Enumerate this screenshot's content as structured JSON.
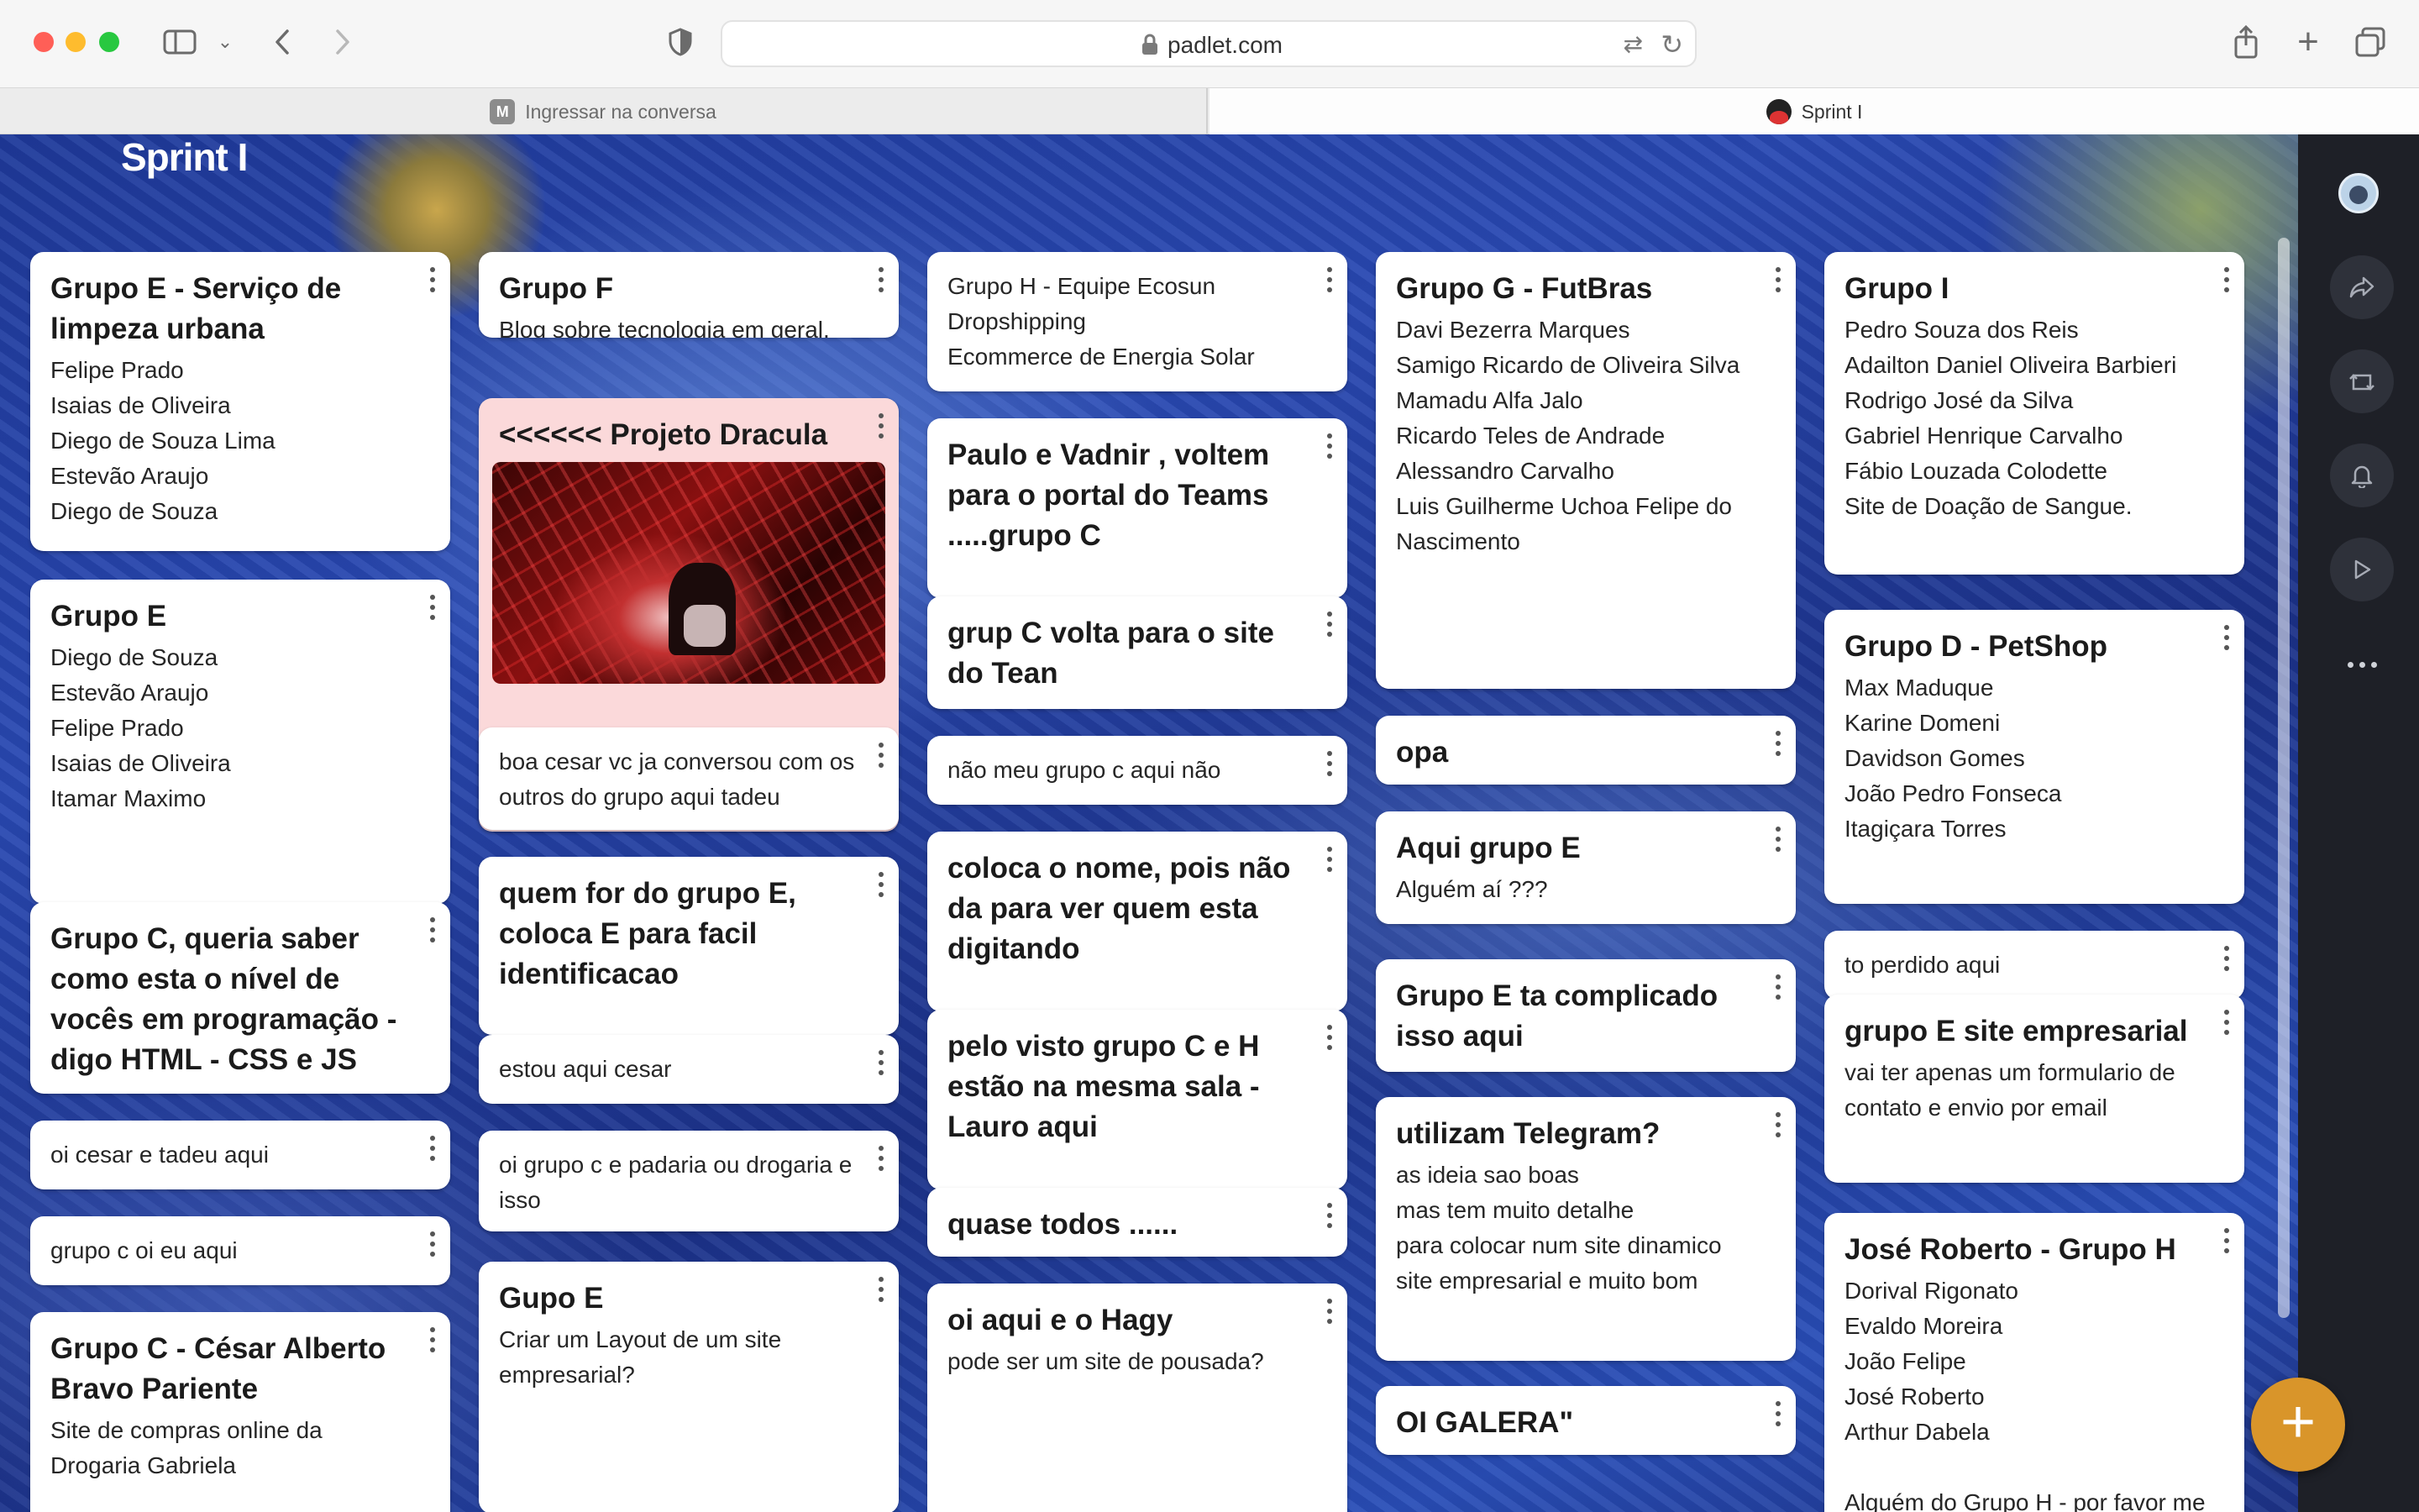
{
  "browser": {
    "url": "padlet.com",
    "tabs": [
      {
        "label": "Ingressar na conversa",
        "favicon": "M"
      },
      {
        "label": "Sprint I"
      }
    ]
  },
  "board": {
    "title": "Sprint I",
    "colors": {
      "card": "#ffffff",
      "pink_card": "#fbd9da",
      "fab": "#d9952a",
      "sidebar": "#1e2027"
    },
    "cards": [
      {
        "title": "Grupo E - Serviço de limpeza urbana",
        "body": "Felipe Prado\nIsaias de Oliveira\nDiego de Souza Lima\nEstevão Araujo\nDiego de Souza"
      },
      {
        "title": "Grupo E",
        "body": "Diego de Souza\nEstevão Araujo\nFelipe Prado\nIsaias de Oliveira\nItamar Maximo"
      },
      {
        "title": "Grupo C, queria saber como esta o nível de vocês em programação - digo HTML - CSS e JS",
        "body": ""
      },
      {
        "title": "",
        "body": "oi cesar e tadeu aqui"
      },
      {
        "title": "",
        "body": "grupo c oi eu aqui"
      },
      {
        "title": "Grupo C - César Alberto Bravo Pariente",
        "body": "Site de compras online da\nDrogaria Gabriela"
      },
      {
        "title": "Grupo F",
        "body": "Blog sobre tecnologia em geral."
      },
      {
        "title": "<<<<<< Projeto Dracula",
        "body": ""
      },
      {
        "title": "",
        "body": "boa cesar vc ja conversou com os outros do grupo aqui tadeu"
      },
      {
        "title": "quem for do grupo E, coloca E para facil identificacao",
        "body": ""
      },
      {
        "title": "",
        "body": "estou aqui cesar"
      },
      {
        "title": "",
        "body": "oi grupo c e padaria ou drogaria e isso"
      },
      {
        "title": "Gupo E",
        "body": "Criar um Layout de um site empresarial?"
      },
      {
        "title": "",
        "body": "Grupo H - Equipe Ecosun\nDropshipping\nEcommerce de Energia Solar"
      },
      {
        "title": "Paulo e Vadnir , voltem para o portal do Teams .....grupo C",
        "body": ""
      },
      {
        "title": "grup C volta para o site do Tean",
        "body": ""
      },
      {
        "title": "",
        "body": "não meu grupo c aqui não"
      },
      {
        "title": "coloca o nome, pois não da para ver quem esta digitando",
        "body": ""
      },
      {
        "title": "pelo visto grupo C e H estão na mesma sala - Lauro aqui",
        "body": ""
      },
      {
        "title": "quase todos ......",
        "body": ""
      },
      {
        "title": "oi aqui e o Hagy",
        "body": "pode ser um site de pousada?"
      },
      {
        "title": "Grupo G - FutBras",
        "body": "Davi Bezerra Marques\nSamigo Ricardo de Oliveira Silva\nMamadu Alfa Jalo\nRicardo Teles de Andrade\nAlessandro Carvalho\nLuis Guilherme Uchoa Felipe do Nascimento"
      },
      {
        "title": "opa",
        "body": ""
      },
      {
        "title": "Aqui grupo E",
        "body": "Alguém aí ???"
      },
      {
        "title": "Grupo E ta complicado isso aqui",
        "body": ""
      },
      {
        "title": "utilizam Telegram?",
        "body": "as ideia sao boas\nmas tem muito detalhe\npara colocar num site dinamico\nsite empresarial  e muito bom"
      },
      {
        "title": "OI GALERA\"",
        "body": ""
      },
      {
        "title": "Grupo I",
        "body": "Pedro  Souza dos Reis\nAdailton Daniel Oliveira Barbieri\nRodrigo José da Silva\nGabriel Henrique Carvalho\nFábio Louzada Colodette\nSite de Doação de Sangue."
      },
      {
        "title": "Grupo D - PetShop",
        "body": "Max Maduque\nKarine  Domeni\nDavidson Gomes\nJoão Pedro Fonseca\nItagiçara Torres"
      },
      {
        "title": "",
        "body": "to perdido aqui"
      },
      {
        "title": "grupo E site empresarial",
        "body": "vai ter apenas um formulario de contato e envio por email"
      },
      {
        "title": "José Roberto - Grupo H",
        "body": "Dorival Rigonato\nEvaldo Moreira\nJoão Felipe\nJosé Roberto\nArthur Dabela\n\nAlguém do Grupo H - por favor me"
      }
    ]
  },
  "sidebar": {
    "icons": [
      "avatar",
      "share-icon",
      "remake-icon",
      "bell-icon",
      "play-icon",
      "more-icon"
    ],
    "fab_label": "+"
  }
}
